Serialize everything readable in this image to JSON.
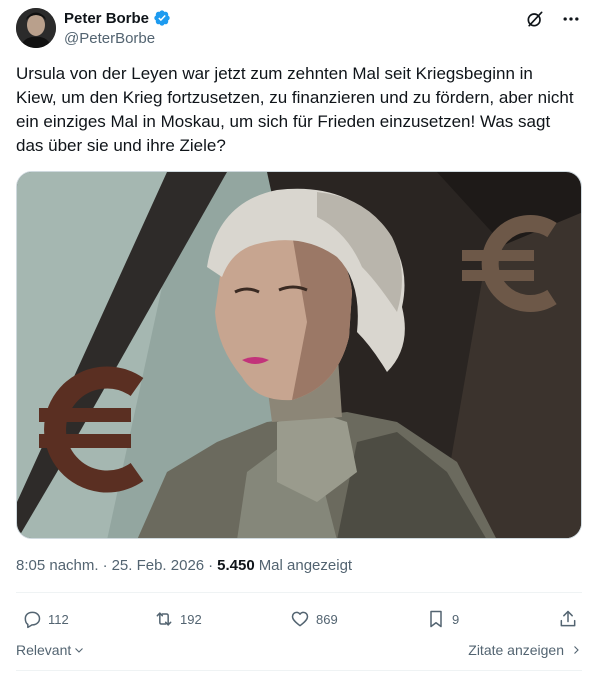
{
  "author": {
    "display_name": "Peter Borbe",
    "handle": "@PeterBorbe",
    "verified": true,
    "avatar_icon": "avatar-photo"
  },
  "header_actions": {
    "grok_icon": "grok-icon",
    "more_icon": "more-icon"
  },
  "tweet": {
    "text": "Ursula von der Leyen war jetzt zum zehnten Mal seit Kriegsbeginn in Kiew, um den Krieg fortzusetzen, zu finanzieren und zu fördern, aber nicht ein einziges Mal in Moskau, um sich für Frieden einzusetzen! Was sagt das über sie und ihre Ziele?"
  },
  "meta": {
    "time": "8:05 nachm.",
    "separator": "·",
    "date": "25. Feb. 2026",
    "views_count": "5.450",
    "views_label": "Mal angezeigt"
  },
  "actions": {
    "replies": "112",
    "reposts": "192",
    "likes": "869",
    "bookmarks": "9"
  },
  "footer": {
    "sort_label": "Relevant",
    "quotes_label": "Zitate anzeigen"
  },
  "colors": {
    "accent": "#1d9bf0",
    "text_primary": "#0f1419",
    "text_secondary": "#536471",
    "border": "#eff3f4"
  }
}
